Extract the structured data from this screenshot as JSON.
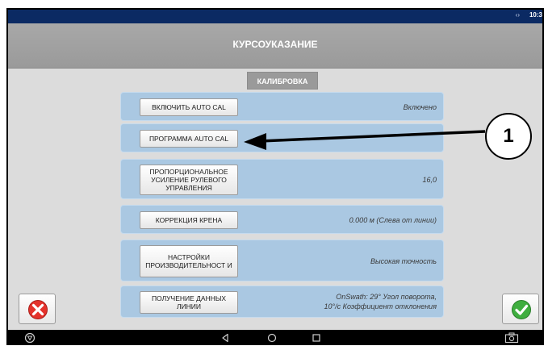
{
  "status_bar": {
    "signal_text": "‹›",
    "time": "10:3"
  },
  "header": {
    "title": "КУРСОУКАЗАНИЕ"
  },
  "tab": {
    "label": "КАЛИБРОВКА"
  },
  "rows": [
    {
      "button": "ВКЛЮЧИТЬ AUTO CAL",
      "value": "Включено"
    },
    {
      "button": "ПРОГРАММА AUTO CAL",
      "value": ""
    },
    {
      "button": "ПРОПОРЦИОНАЛЬНОЕ УСИЛЕНИЕ РУЛЕВОГО УПРАВЛЕНИЯ",
      "value": "16,0"
    },
    {
      "button": "КОРРЕКЦИЯ КРЕНА",
      "value": "0.000 м (Слева от линии)"
    },
    {
      "button": "НАСТРОЙКИ ПРОИЗВОДИТЕЛЬНОСТ И",
      "value": "Высокая точность"
    },
    {
      "button": "ПОЛУЧЕНИЕ ДАННЫХ ЛИНИИ",
      "value_line1": "OnSwath: 29° Угол поворота,",
      "value_line2": "10°/c Коэффициент отклонения"
    }
  ],
  "callout": {
    "number": "1"
  },
  "icons": {
    "cancel": "close-icon",
    "confirm": "check-icon",
    "nav_power": "power-icon",
    "nav_back": "back-icon",
    "nav_home": "home-icon",
    "nav_recent": "recent-apps-icon",
    "nav_screenshot": "camera-icon"
  },
  "colors": {
    "status_bar": "#0b2a63",
    "row_fill": "#aac8e2",
    "cancel_red": "#e4322b",
    "confirm_green": "#3fae3f"
  }
}
